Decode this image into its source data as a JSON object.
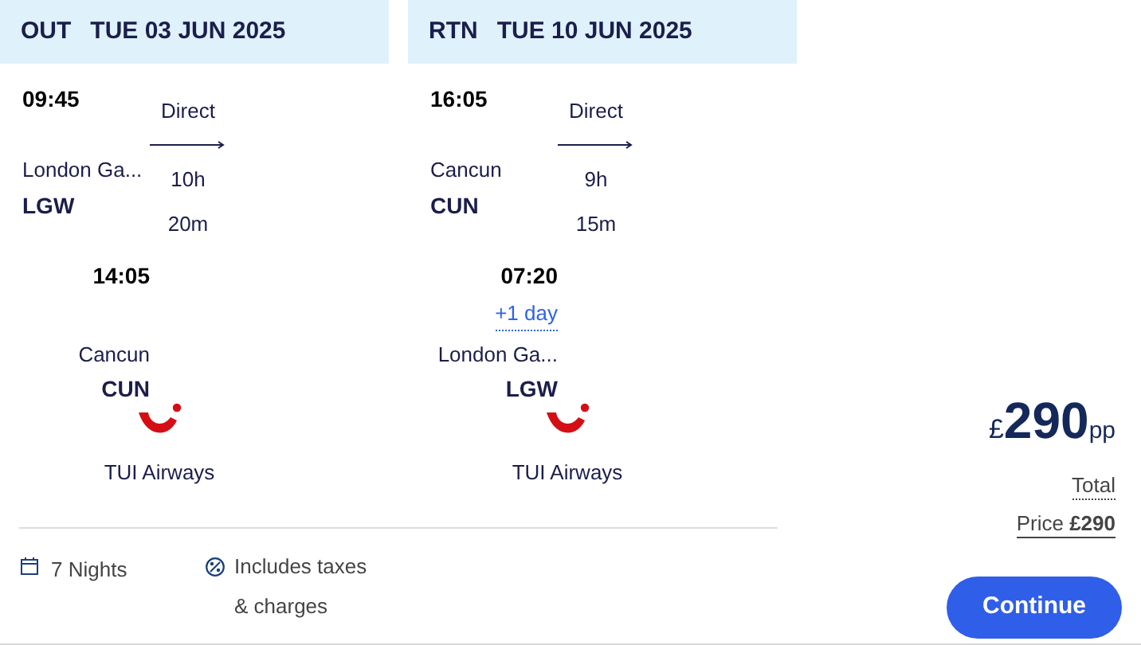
{
  "legs": [
    {
      "direction": "OUT",
      "date": "TUE 03 JUN 2025",
      "departure": {
        "time": "09:45",
        "city": "London Ga...",
        "code": "LGW"
      },
      "stops": "Direct",
      "duration": [
        "10h",
        "20m"
      ],
      "arrival": {
        "time": "14:05",
        "city": "Cancun",
        "code": "CUN"
      },
      "airline": "TUI Airways"
    },
    {
      "direction": "RTN",
      "date": "TUE 10 JUN 2025",
      "departure": {
        "time": "16:05",
        "city": "Cancun",
        "code": "CUN"
      },
      "stops": "Direct",
      "duration": [
        "9h",
        "15m"
      ],
      "arrival": {
        "time": "07:20",
        "day_offset": "+1 day",
        "city": "London Ga...",
        "code": "LGW"
      },
      "airline": "TUI Airways"
    }
  ],
  "footer": {
    "nights": "7 Nights",
    "taxes": "Includes taxes & charges"
  },
  "price": {
    "currency": "£",
    "amount": "290",
    "unit": "pp",
    "total_label": "Total",
    "total_price": "Price **£290**"
  },
  "button": "Continue"
}
